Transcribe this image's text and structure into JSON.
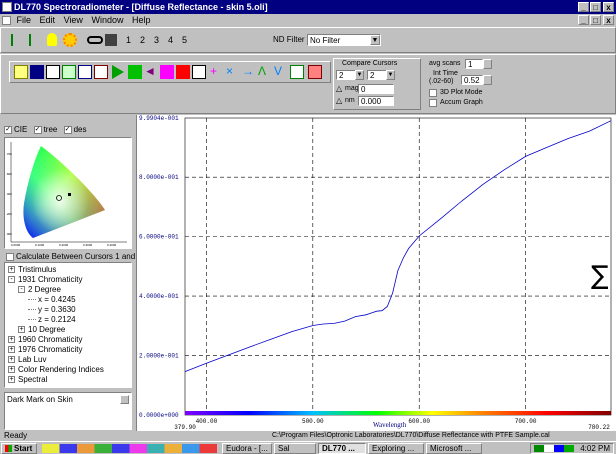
{
  "window": {
    "title": "DL770 Spectroradiometer - [Diffuse Reflectance - skin 5.oli]",
    "controls": [
      "_",
      "□",
      "x"
    ],
    "child_controls": [
      "_",
      "□",
      "x"
    ]
  },
  "menu": [
    "File",
    "Edit",
    "View",
    "Window",
    "Help"
  ],
  "toolbar": {
    "pages": [
      "1",
      "2",
      "3",
      "4",
      "5"
    ],
    "nd_filter_label": "ND Filter",
    "nd_filter_value": "No Filter"
  },
  "compare": {
    "label": "Compare Cursors",
    "cursor_a": "2",
    "cursor_b": "2",
    "mag_label": "mag",
    "mag_value": "0",
    "nm_label": "nm",
    "nm_value": "0.000"
  },
  "scan": {
    "avg_label": "avg scans",
    "avg_value": "1",
    "int_time_label": "Int Time",
    "int_time_range": "(.02-60)",
    "int_time_value": "0.52",
    "plot3d_label": "3D Plot Mode",
    "accum_label": "Accum Graph"
  },
  "left_panel": {
    "checks": [
      {
        "label": "CIE",
        "checked": true
      },
      {
        "label": "tree",
        "checked": true
      },
      {
        "label": "des",
        "checked": true
      }
    ],
    "cie_y_ticks": [
      ".700",
      ".600",
      ".400",
      ".200",
      ".000"
    ],
    "cie_x_ticks": [
      "0.0000",
      "0.1000",
      "0.2000",
      "0.3000",
      "0.4000"
    ],
    "calc_label": "Calculate Between Cursors 1 and 2",
    "tree": [
      {
        "sign": "+",
        "label": "Tristimulus",
        "indent": 0
      },
      {
        "sign": "-",
        "label": "1931 Chromaticity",
        "indent": 0
      },
      {
        "sign": "-",
        "label": "2 Degree",
        "indent": 1
      },
      {
        "sign": "",
        "label": "x = 0.4245",
        "indent": 2
      },
      {
        "sign": "",
        "label": "y = 0.3630",
        "indent": 2
      },
      {
        "sign": "",
        "label": "z = 0.2124",
        "indent": 2
      },
      {
        "sign": "+",
        "label": "10 Degree",
        "indent": 1
      },
      {
        "sign": "+",
        "label": "1960 Chromaticity",
        "indent": 0
      },
      {
        "sign": "+",
        "label": "1976 Chromaticity",
        "indent": 0
      },
      {
        "sign": "+",
        "label": "Lab Luv",
        "indent": 0
      },
      {
        "sign": "+",
        "label": "Color Rendering Indices",
        "indent": 0
      },
      {
        "sign": "+",
        "label": "Spectral",
        "indent": 0
      }
    ],
    "description": "Dark Mark on Skin"
  },
  "chart_data": {
    "type": "line",
    "x": [
      379.9,
      400,
      420,
      440,
      460,
      480,
      500,
      510,
      520,
      530,
      540,
      550,
      555,
      560,
      565,
      570,
      575,
      580,
      585,
      590,
      600,
      620,
      640,
      660,
      680,
      700,
      720,
      740,
      760,
      780.22
    ],
    "values": [
      0.146,
      0.174,
      0.201,
      0.228,
      0.254,
      0.28,
      0.301,
      0.306,
      0.308,
      0.316,
      0.331,
      0.337,
      0.343,
      0.349,
      0.351,
      0.365,
      0.41,
      0.486,
      0.528,
      0.56,
      0.602,
      0.66,
      0.72,
      0.776,
      0.825,
      0.87,
      0.9,
      0.93,
      0.955,
      0.99
    ],
    "xlim": [
      379.9,
      780.22
    ],
    "ylim": [
      0.0,
      0.99904
    ],
    "y_ticks": [
      "9.9904e-001",
      "8.0000e-001",
      "6.0000e-001",
      "4.0000e-001",
      "2.0000e-001",
      "0.0000e+000"
    ],
    "y_tick_values": [
      0.99904,
      0.8,
      0.6,
      0.4,
      0.2,
      0.0
    ],
    "x_ticks": [
      "400.00",
      "500.00",
      "600.00",
      "700.00"
    ],
    "x_tick_values": [
      400,
      500,
      600,
      700
    ],
    "x_min_label": "379.90",
    "x_max_label": "780.22",
    "xlabel": "Wavelength",
    "line_color": "#0000cc",
    "grid": true
  },
  "status": {
    "left": "Ready",
    "path": "C:\\Program Files\\Optronic Laboratories\\DL770\\Diffuse Reflectance with PTFE Sample.cal"
  },
  "taskbar": {
    "start": "Start",
    "items": [
      "Eudora - [...",
      "Sal",
      "DL770 ...",
      "Exploring ...",
      "Microsoft ..."
    ],
    "clock": "4:02 PM"
  }
}
